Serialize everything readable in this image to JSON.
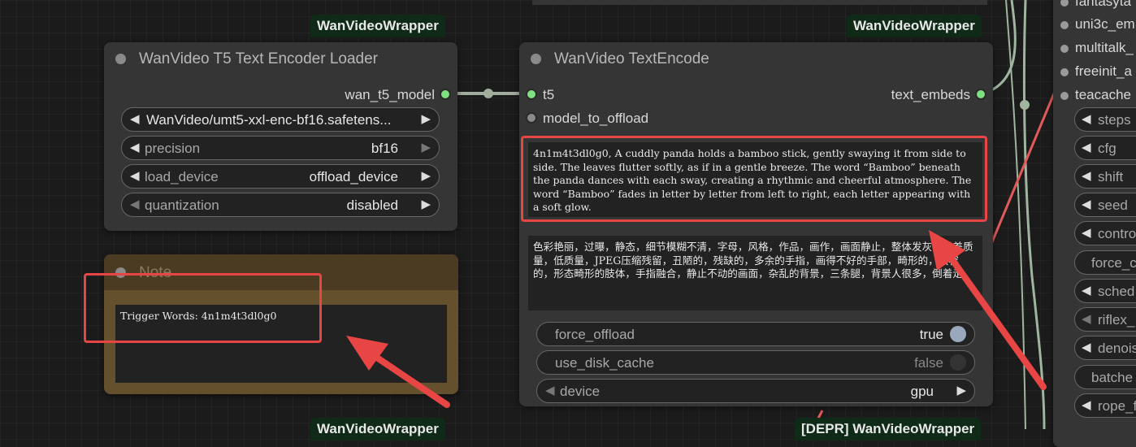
{
  "badges": {
    "loader": "WanVideoWrapper",
    "encode": "WanVideoWrapper",
    "bottom_left": "WanVideoWrapper",
    "bottom_right": "[DEPR] WanVideoWrapper"
  },
  "t5_loader": {
    "title": "WanVideo T5 Text Encoder Loader",
    "output": "wan_t5_model",
    "widgets": [
      {
        "label": "",
        "value": "WanVideo/umt5-xxl-enc-bf16.safetens..."
      },
      {
        "label": "precision",
        "value": "bf16"
      },
      {
        "label": "load_device",
        "value": "offload_device"
      },
      {
        "label": "quantization",
        "value": "disabled"
      }
    ]
  },
  "note": {
    "title": "Note",
    "text": "Trigger Words: 4n1m4t3dl0g0"
  },
  "text_encode": {
    "title": "WanVideo TextEncode",
    "inputs": [
      "t5",
      "model_to_offload"
    ],
    "output": "text_embeds",
    "positive_prompt": "4n1m4t3dl0g0, A cuddly panda holds a bamboo stick, gently swaying it from side to side. The leaves flutter softly, as if in a gentle breeze. The word “Bamboo” beneath the panda dances with each sway, creating a rhythmic and cheerful atmosphere. The word “Bamboo” fades in letter by letter from left to right, each letter appearing with a soft glow.",
    "negative_prompt": "色彩艳丽，过曝，静态，细节模糊不清，字母，风格，作品，画作，画面静止，整体发灰，最差质量，低质量，JPEG压缩残留，丑陋的，残缺的，多余的手指，画得不好的手部，畸形的，毁容的，形态畸形的肢体，手指融合，静止不动的画面，杂乱的背景，三条腿，背景人很多，倒着走",
    "toggles": [
      {
        "label": "force_offload",
        "value": "true"
      },
      {
        "label": "use_disk_cache",
        "value": "false"
      }
    ],
    "device": {
      "label": "device",
      "value": "gpu"
    }
  },
  "right_node": {
    "inputs": [
      "fantasyta",
      "uni3c_em",
      "multitalk_",
      "freeinit_a",
      "teacache"
    ],
    "widgets": [
      "steps",
      "cfg",
      "shift",
      "seed",
      "contro",
      "force_c",
      "sched",
      "riflex_",
      "denois",
      "batche",
      "rope_f"
    ]
  },
  "colors": {
    "badge_bg": "#0f2a17",
    "node_bg": "#353535",
    "note_bg": "#64502d",
    "highlight": "#e84545",
    "link_green": "#9fb59f"
  }
}
